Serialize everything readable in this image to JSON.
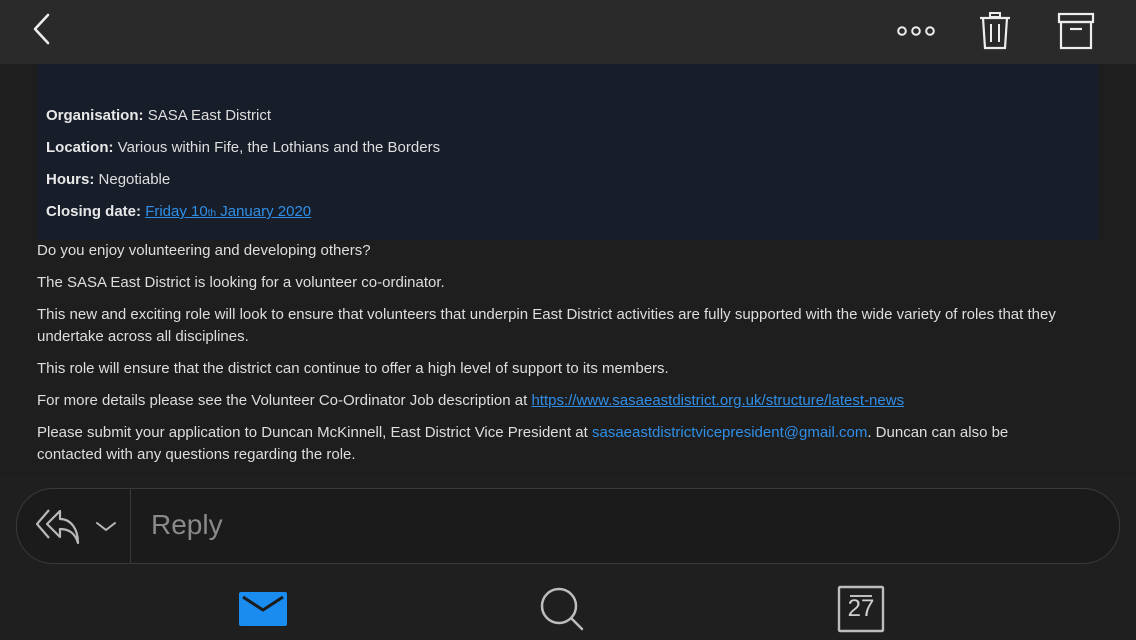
{
  "header": {
    "back_icon": "chevron-left-icon",
    "more_icon": "more-horizontal-icon",
    "delete_icon": "trash-icon",
    "archive_icon": "archive-icon"
  },
  "info": {
    "organisation_label": "Organisation:",
    "organisation_value": "SASA East District",
    "location_label": "Location:",
    "location_value": "Various within Fife, the Lothians and the Borders",
    "hours_label": "Hours:",
    "hours_value": "Negotiable",
    "closing_label": "Closing date:",
    "closing_pre": "Friday 10",
    "closing_sup": "th",
    "closing_post": " January 2020"
  },
  "body": {
    "p1": "Do you enjoy volunteering and developing others?",
    "p2": "The SASA East District is looking for a volunteer co-ordinator.",
    "p3": "This new and exciting role will look to ensure that volunteers that underpin East District activities are fully supported with the wide variety of roles that they undertake across all disciplines.",
    "p4": "This role will ensure that the district can continue to offer a high level of support to its members.",
    "p5_text": "For more details please see the Volunteer Co-Ordinator Job description at ",
    "p5_link": "https://www.sasaeastdistrict.org.uk/structure/latest-news",
    "p6_text": "Please submit your application to Duncan McKinnell, East District Vice President at ",
    "p6_email": "sasaeastdistrictvicepresident@gmail.com",
    "p6_tail": ". Duncan can also be contacted with any questions regarding the role."
  },
  "reply": {
    "placeholder": "Reply",
    "reply_icon": "reply-all-icon",
    "dropdown_icon": "chevron-down-icon"
  },
  "tabbar": {
    "mail_icon": "mail-icon",
    "search_icon": "search-icon",
    "calendar_icon": "calendar-icon",
    "calendar_day": "27",
    "accent": "#1a8cf0"
  }
}
